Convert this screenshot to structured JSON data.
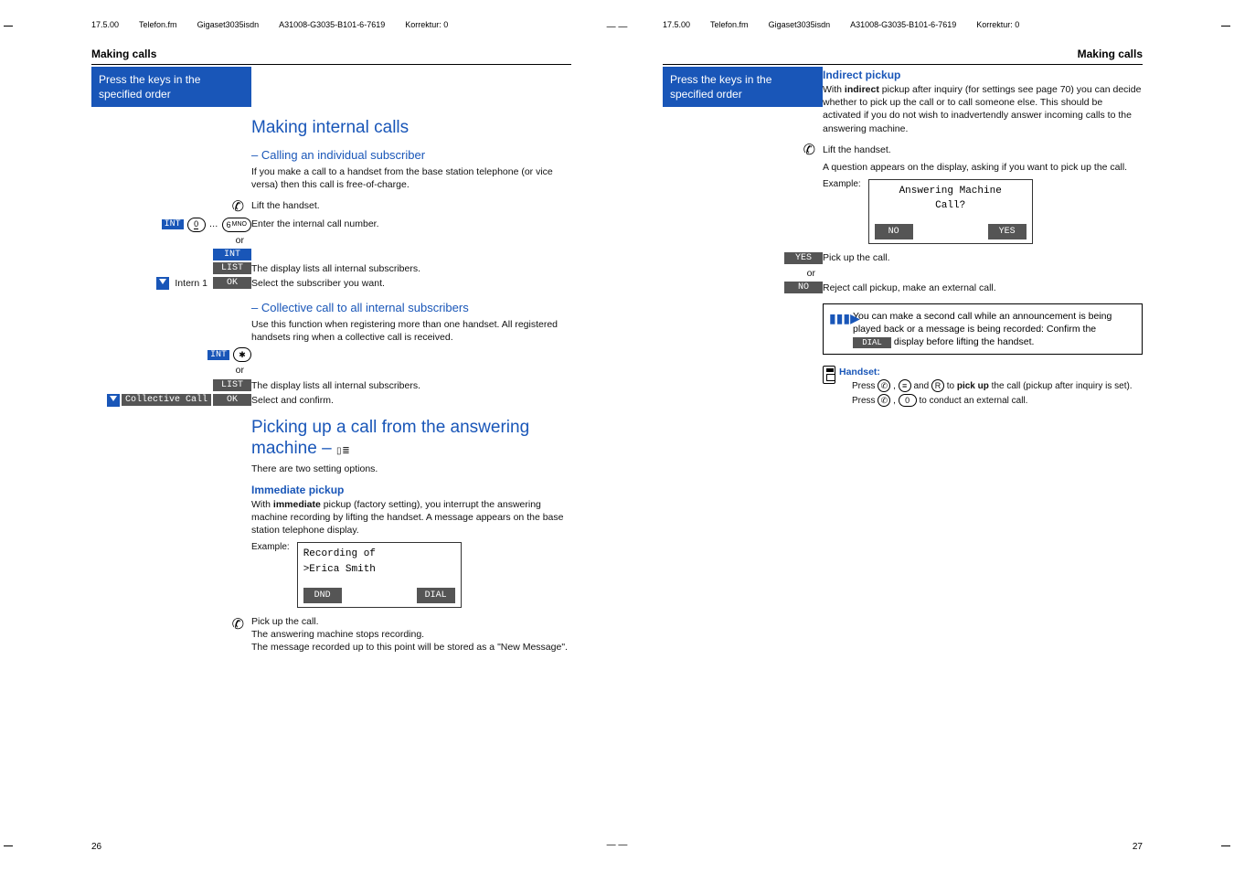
{
  "top": {
    "date": "17.5.00",
    "file": "Telefon.fm",
    "prod": "Gigaset3035isdn",
    "part": "A31008-G3035-B101-6-7619",
    "korr": "Korrektur: 0"
  },
  "left": {
    "section": "Making calls",
    "note1a": "Press the keys in the",
    "note1b": "specified order",
    "h1": "Making internal calls",
    "sub1": "–  Calling an individual subscriber",
    "p1": "If you make a call to a handset from the base station telephone (or vice versa) then this call is free-of-charge.",
    "lift": "Lift the handset.",
    "enter_internal": "Enter the internal call number.",
    "or": "or",
    "int": "INT",
    "list": "LIST",
    "list_desc": "The display lists all internal subscribers.",
    "intern1": "Intern 1",
    "ok": "OK",
    "select_sub": "Select the subscriber you want.",
    "sub2": "–  Collective call to all internal subscribers",
    "p2": "Use this function when registering more than one handset. All registered handsets ring when a collective call is received.",
    "list_desc2": "The display lists all internal subscribers.",
    "collective": "Collective Call",
    "select_confirm": "Select and confirm.",
    "h2a": "Picking up a call from the answering",
    "h2b": "machine – ",
    "p3": "There are two setting options.",
    "immediate": "Immediate pickup",
    "p4a": "With ",
    "p4b": "immediate",
    "p4c": " pickup (factory setting), you interrupt the answering machine recording by lifting the handset. A message appears on the base station telephone display.",
    "example": "Example:",
    "lcd1_l1": "Recording of",
    "lcd1_l2": ">Erica Smith",
    "btn_dnd": "DND",
    "btn_dial": "DIAL",
    "pickup": "Pick up the call.",
    "stops": "The answering machine stops recording.",
    "stored": "The message recorded up to this point will be stored as a \"New Message\".",
    "pagenum": "26"
  },
  "right": {
    "section": "Making calls",
    "note1a": "Press the keys in the",
    "note1b": "specified order",
    "h1": "Indirect pickup",
    "p1a": "With ",
    "p1b": "indirect",
    "p1c": " pickup after inquiry (for settings see page 70) you can decide whether to pick up the call or to call someone else. This should be activated if you do not wish to inadvertendly answer incoming calls to the answering machine.",
    "lift": "Lift the handset.",
    "q": "A question appears on the display, asking if you want to pick up the call.",
    "example": "Example:",
    "lcd_l1": "Answering Machine",
    "lcd_l2": "Call?",
    "btn_no": "NO",
    "btn_yes": "YES",
    "yes": "YES",
    "pickup": "Pick up the call.",
    "or": "or",
    "no": "NO",
    "reject": "Reject call pickup, make an external call.",
    "tip": "You can make a second call while an announcement is being played back or a message is being recorded: Confirm the ",
    "tip_dial": "DIAL",
    "tip2": " display before lifting the handset.",
    "handset": "Handset:",
    "hp1a": "Press ",
    "hp1b": " and ",
    "hp1c": " to ",
    "hp1_bold": "pick up",
    "hp1d": " the call (pickup after inquiry is set).",
    "hp2a": "Press ",
    "hp2b": " to conduct an external call.",
    "pagenum": "27"
  }
}
